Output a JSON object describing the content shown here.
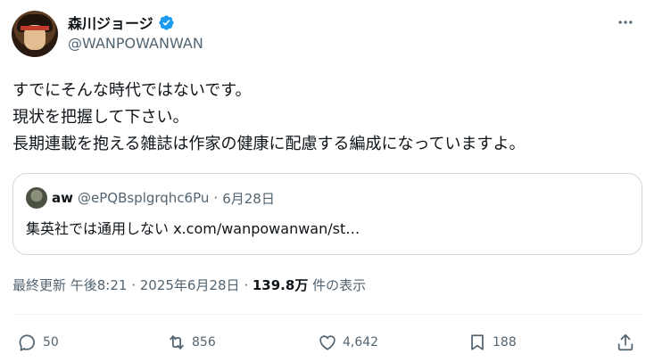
{
  "author": {
    "name": "森川ジョージ",
    "handle": "@WANPOWANWAN",
    "verified_color": "#1d9bf0"
  },
  "tweet": {
    "lines": [
      "すでにそんな時代ではないです。",
      "現状を把握して下さい。",
      "長期連載を抱える雑誌は作家の健康に配慮する編成になっていますよ。"
    ]
  },
  "quote": {
    "name": "aw",
    "handle": "@ePQBsplgrqhc6Pu",
    "separator": "·",
    "date": "6月28日",
    "text": "集英社では通用しない x.com/wanpowanwan/st…"
  },
  "meta": {
    "updated": "最終更新 午後8:21 · 2025年6月28日 · ",
    "views": "139.8万",
    "views_suffix": " 件の表示"
  },
  "actions": {
    "replies": "50",
    "reposts": "856",
    "likes": "4,642",
    "bookmarks": "188"
  },
  "icons": [
    "more-icon",
    "verified-icon",
    "reply-icon",
    "repost-icon",
    "like-icon",
    "bookmark-icon",
    "share-icon"
  ]
}
